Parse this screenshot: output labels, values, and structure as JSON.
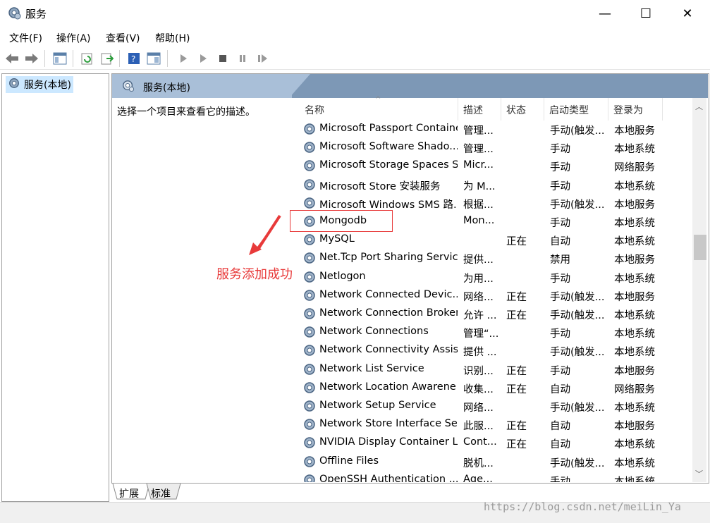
{
  "window": {
    "title": "服务",
    "min": "—",
    "max": "☐",
    "close": "✕"
  },
  "menu": [
    "文件(F)",
    "操作(A)",
    "查看(V)",
    "帮助(H)"
  ],
  "tree": {
    "root": "服务(本地)"
  },
  "panel": {
    "header": "服务(本地)",
    "description": "选择一个项目来查看它的描述。"
  },
  "columns": {
    "name": "名称",
    "desc": "描述",
    "status": "状态",
    "startup": "启动类型",
    "logon": "登录为"
  },
  "services": [
    {
      "name": "Microsoft Passport Container",
      "desc": "管理...",
      "status": "",
      "startup": "手动(触发...",
      "logon": "本地服务"
    },
    {
      "name": "Microsoft Software Shado...",
      "desc": "管理...",
      "status": "",
      "startup": "手动",
      "logon": "本地系统"
    },
    {
      "name": "Microsoft Storage Spaces S",
      "desc": "Micr...",
      "status": "",
      "startup": "手动",
      "logon": "网络服务"
    },
    {
      "name": "Microsoft Store 安装服务",
      "desc": "为 M...",
      "status": "",
      "startup": "手动",
      "logon": "本地系统"
    },
    {
      "name": "Microsoft Windows SMS 路...",
      "desc": "根据...",
      "status": "",
      "startup": "手动(触发...",
      "logon": "本地服务"
    },
    {
      "name": "Mongodb",
      "desc": "Mon...",
      "status": "",
      "startup": "手动",
      "logon": "本地系统"
    },
    {
      "name": "MySQL",
      "desc": "",
      "status": "正在",
      "startup": "自动",
      "logon": "本地系统"
    },
    {
      "name": "Net.Tcp Port Sharing Service",
      "desc": "提供...",
      "status": "",
      "startup": "禁用",
      "logon": "本地服务"
    },
    {
      "name": "Netlogon",
      "desc": "为用...",
      "status": "",
      "startup": "手动",
      "logon": "本地系统"
    },
    {
      "name": "Network Connected Devic...",
      "desc": "网络...",
      "status": "正在",
      "startup": "手动(触发...",
      "logon": "本地服务"
    },
    {
      "name": "Network Connection Broker",
      "desc": "允许 ...",
      "status": "正在",
      "startup": "手动(触发...",
      "logon": "本地系统"
    },
    {
      "name": "Network Connections",
      "desc": "管理“...",
      "status": "",
      "startup": "手动",
      "logon": "本地系统"
    },
    {
      "name": "Network Connectivity Assis...",
      "desc": "提供 ...",
      "status": "",
      "startup": "手动(触发...",
      "logon": "本地系统"
    },
    {
      "name": "Network List Service",
      "desc": "识别...",
      "status": "正在",
      "startup": "手动",
      "logon": "本地服务"
    },
    {
      "name": "Network Location Awarene",
      "desc": "收集...",
      "status": "正在",
      "startup": "自动",
      "logon": "网络服务"
    },
    {
      "name": "Network Setup Service",
      "desc": "网络...",
      "status": "",
      "startup": "手动(触发...",
      "logon": "本地系统"
    },
    {
      "name": "Network Store Interface Se...",
      "desc": "此服...",
      "status": "正在",
      "startup": "自动",
      "logon": "本地服务"
    },
    {
      "name": "NVIDIA Display Container LS",
      "desc": "Cont...",
      "status": "正在",
      "startup": "自动",
      "logon": "本地系统"
    },
    {
      "name": "Offline Files",
      "desc": "脱机...",
      "status": "",
      "startup": "手动(触发...",
      "logon": "本地系统"
    },
    {
      "name": "OpenSSH Authentication ...",
      "desc": "Age...",
      "status": "",
      "startup": "手动",
      "logon": "本地系统"
    }
  ],
  "bottom_tabs": [
    "扩展",
    "标准"
  ],
  "annotation": {
    "text": "服务添加成功",
    "color": "#e83a3a"
  },
  "watermark": "https://blog.csdn.net/meiLin_Ya",
  "colors": {
    "panel_header": "#7d98b6",
    "selection": "#cce8ff",
    "accent_red": "#e83a3a"
  }
}
